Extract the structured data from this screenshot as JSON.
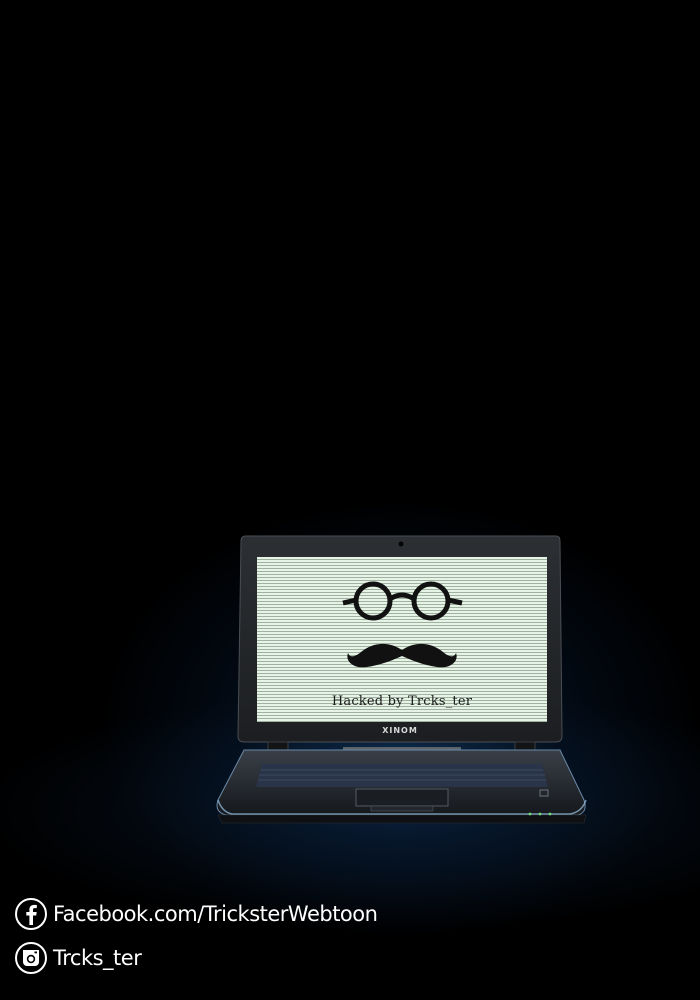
{
  "screen": {
    "message": "Hacked by Trcks_ter"
  },
  "laptop": {
    "brand": "XINOM"
  },
  "social": [
    {
      "icon": "facebook-icon",
      "label": "Facebook.com/TricksterWebtoon"
    },
    {
      "icon": "instagram-icon",
      "label": "Trcks_ter"
    }
  ],
  "colors": {
    "background": "#000000",
    "screen": "#e7f3e6",
    "glow": "#14467a",
    "text": "#ffffff"
  }
}
